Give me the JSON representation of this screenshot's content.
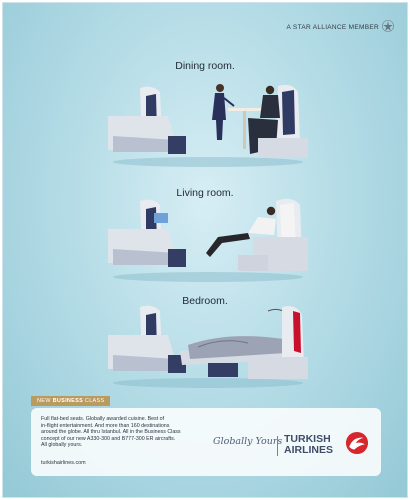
{
  "header": {
    "alliance_text": "A STAR ALLIANCE MEMBER"
  },
  "scenes": [
    {
      "title": "Dining room."
    },
    {
      "title": "Living room."
    },
    {
      "title": "Bedroom."
    }
  ],
  "badge": {
    "prefix": "NEW ",
    "highlight": "BUSINESS",
    "suffix": " CLASS"
  },
  "copy": {
    "lines": [
      "Full flat-bed seats. Globally awarded cuisine. Best of",
      "in-flight entertainment. And more than 160 destinations",
      "around the globe. All thru Istanbul. All in the Business Class",
      "concept of our new A330-300 and B777-300 ER aircrafts.",
      "All globally yours."
    ],
    "url": "turkishairlines.com"
  },
  "brand": {
    "tagline": "Globally Yours",
    "name_line1": "TURKISH",
    "name_line2": "AIRLINES",
    "logo_color": "#d8262e"
  },
  "colors": {
    "seat_frame": "#e7eaef",
    "seat_shell": "#d5d9e1",
    "seat_back": "#3c456a",
    "accent_red": "#c8102e",
    "badge": "#b99a5f"
  }
}
